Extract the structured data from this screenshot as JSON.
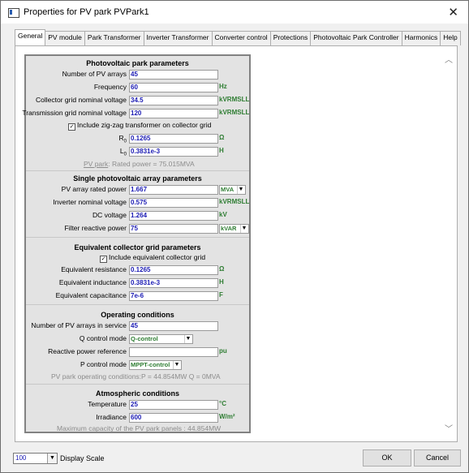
{
  "window": {
    "title": "Properties for PV park PVPark1",
    "close_label": "✕"
  },
  "tabs": [
    "General",
    "PV module",
    "Park Transformer",
    "Inverter Transformer",
    "Converter control",
    "Protections",
    "Photovoltaic Park Controller",
    "Harmonics",
    "Help"
  ],
  "active_tab": "General",
  "pv_park": {
    "title": "Photovoltaic park parameters",
    "num_arrays": {
      "label": "Number of PV arrays",
      "value": "45",
      "unit": ""
    },
    "frequency": {
      "label": "Frequency",
      "value": "60",
      "unit": "Hz"
    },
    "collector_voltage": {
      "label": "Collector grid nominal voltage",
      "value": "34.5",
      "unit": "kVRMSLL"
    },
    "transmission_voltage": {
      "label": "Transmission grid nominal voltage",
      "value": "120",
      "unit": "kVRMSLL"
    },
    "zigzag": {
      "label": "Include zig-zag transformer on collector grid",
      "checked": true
    },
    "r0": {
      "label_main": "R",
      "label_sub": "0",
      "value": "0.1265",
      "unit": "Ω"
    },
    "l0": {
      "label_main": "L",
      "label_sub": "0",
      "value": "0.3831e-3",
      "unit": "H"
    },
    "rated_link": "PV park",
    "rated_text": ": Rated power = 75.015MVA"
  },
  "single_array": {
    "title": "Single photovoltaic array parameters",
    "rated_power": {
      "label": "PV array rated power",
      "value": "1.667",
      "unit": "MVA"
    },
    "inverter_voltage": {
      "label": "Inverter nominal voltage",
      "value": "0.575",
      "unit": "kVRMSLL"
    },
    "dc_voltage": {
      "label": "DC voltage",
      "value": "1.264",
      "unit": "kV"
    },
    "filter_power": {
      "label": "Filter reactive power",
      "value": "75",
      "unit": "kVAR"
    }
  },
  "collector_grid": {
    "title": "Equivalent collector grid parameters",
    "include": {
      "label": "Include equivalent collector grid",
      "checked": true
    },
    "resistance": {
      "label": "Equivalent resistance",
      "value": "0.1265",
      "unit": "Ω"
    },
    "inductance": {
      "label": "Equivalent inductance",
      "value": "0.3831e-3",
      "unit": "H"
    },
    "capacitance": {
      "label": "Equivalent capacitance",
      "value": "7e-6",
      "unit": "F"
    }
  },
  "operating": {
    "title": "Operating conditions",
    "arrays_in_service": {
      "label": "Number of PV arrays in service",
      "value": "45"
    },
    "q_mode": {
      "label": "Q control mode",
      "value": "Q-control"
    },
    "reactive_ref": {
      "label": "Reactive power reference",
      "value": "",
      "unit": "pu"
    },
    "p_mode": {
      "label": "P control mode",
      "value": "MPPT-control"
    },
    "status": "PV park operating conditions:P = 44.854MW   Q = 0MVA"
  },
  "atmospheric": {
    "title": "Atmospheric conditions",
    "temperature": {
      "label": "Temperature",
      "value": "25",
      "unit": "°C"
    },
    "irradiance": {
      "label": "Irradiance",
      "value": "600",
      "unit": "W/m²"
    },
    "max_capacity": "Maximum capacity of the PV park panels : 44.854MW"
  },
  "footer": {
    "scale_value": "100",
    "scale_label": "Display Scale",
    "ok_label": "OK",
    "cancel_label": "Cancel"
  },
  "colors": {
    "value_text": "#1b1bb4",
    "unit_text": "#2e7d32",
    "panel_bg": "#e3e3e3"
  }
}
